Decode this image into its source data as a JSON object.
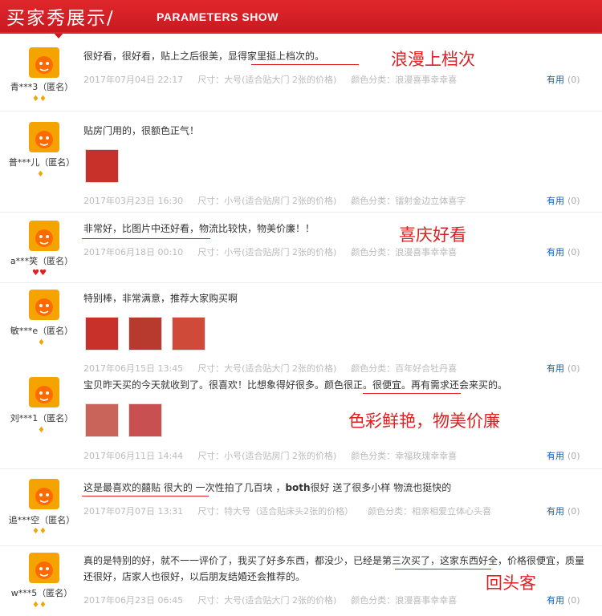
{
  "header": {
    "title_zh": "买家秀展示/",
    "title_en": "PARAMETERS SHOW"
  },
  "colors": {
    "brand_red": "#e0272c",
    "link_blue": "#1a5fb4",
    "annotation_red": "#e02020"
  },
  "reviews": [
    {
      "user": "青***3（匿名）",
      "badge": "♦♦",
      "text": "很好看，很好看，贴上之后很美，显得家里挺上档次的。",
      "date": "2017年07月04日 22:17",
      "size": "尺寸：大号(适合贴大门 2张的价格)",
      "color": "颜色分类：浪漫喜事幸幸喜",
      "useful": "有用",
      "count": "(0)",
      "annotation": "浪漫上档次"
    },
    {
      "user": "普***儿（匿名）",
      "badge": "♦",
      "text": "贴房门用的，很额色正气！",
      "date": "2017年03月23日 16:30",
      "size": "尺寸：小号(适合贴房门 2张的价格)",
      "color": "颜色分类：镭射金边立体喜字",
      "useful": "有用",
      "count": "(0)"
    },
    {
      "user": "a***笑（匿名）",
      "badge": "♥♥",
      "text": "非常好，比图片中还好看，物流比较快，物美价廉！！",
      "date": "2017年06月18日 00:10",
      "size": "尺寸：小号(适合贴房门 2张的价格)",
      "color": "颜色分类：浪漫喜事幸幸喜",
      "useful": "有用",
      "count": "(0)",
      "annotation": "喜庆好看"
    },
    {
      "user": "敏***e（匿名）",
      "badge": "♦",
      "text": "特别棒，非常满意，推荐大家购买啊",
      "date": "2017年06月15日 13:45",
      "size": "尺寸：大号(适合贴大门 2张的价格)",
      "color": "颜色分类：百年好合牡丹喜",
      "useful": "有用",
      "count": "(0)"
    },
    {
      "user": "刘***1（匿名）",
      "badge": "♦",
      "text": "宝贝昨天买的今天就收到了。很喜欢！比想象得好很多。颜色很正。很便宜。再有需求还会来买的。",
      "date": "2017年06月11日 14:44",
      "size": "尺寸：小号(适合贴房门 2张的价格)",
      "color": "颜色分类：幸福玫瑰幸幸喜",
      "useful": "有用",
      "count": "(0)",
      "annotation": "色彩鲜艳，物美价廉"
    },
    {
      "user": "追***空（匿名）",
      "badge": "♦♦",
      "text_part1": "这是最喜欢的囍贴 很大的",
      "text_part2": " 一次性拍了几百块 ，",
      "text_part3": "both",
      "text_part4": "很好 送了很多小样 物流也挺快的",
      "date": "2017年07月07日 13:31",
      "size": "尺寸：特大号（适合贴床头2张的价格）",
      "color": "颜色分类：相亲相爱立体心头喜",
      "useful": "有用",
      "count": "(0)"
    },
    {
      "user": "w***5（匿名）",
      "badge": "♦♦",
      "text": "真的是特别的好，就不一一评价了，我买了好多东西，都没少，已经是第三次买了，这家东西好全，价格很便宜，质量还很好，店家人也很好，以后朋友结婚还会推荐的。",
      "date": "2017年06月23日 06:45",
      "size": "尺寸：大号(适合贴大门 2张的价格)",
      "color": "颜色分类：浪漫喜事幸幸喜",
      "useful": "有用",
      "count": "(0)",
      "annotation": "回头客"
    }
  ]
}
